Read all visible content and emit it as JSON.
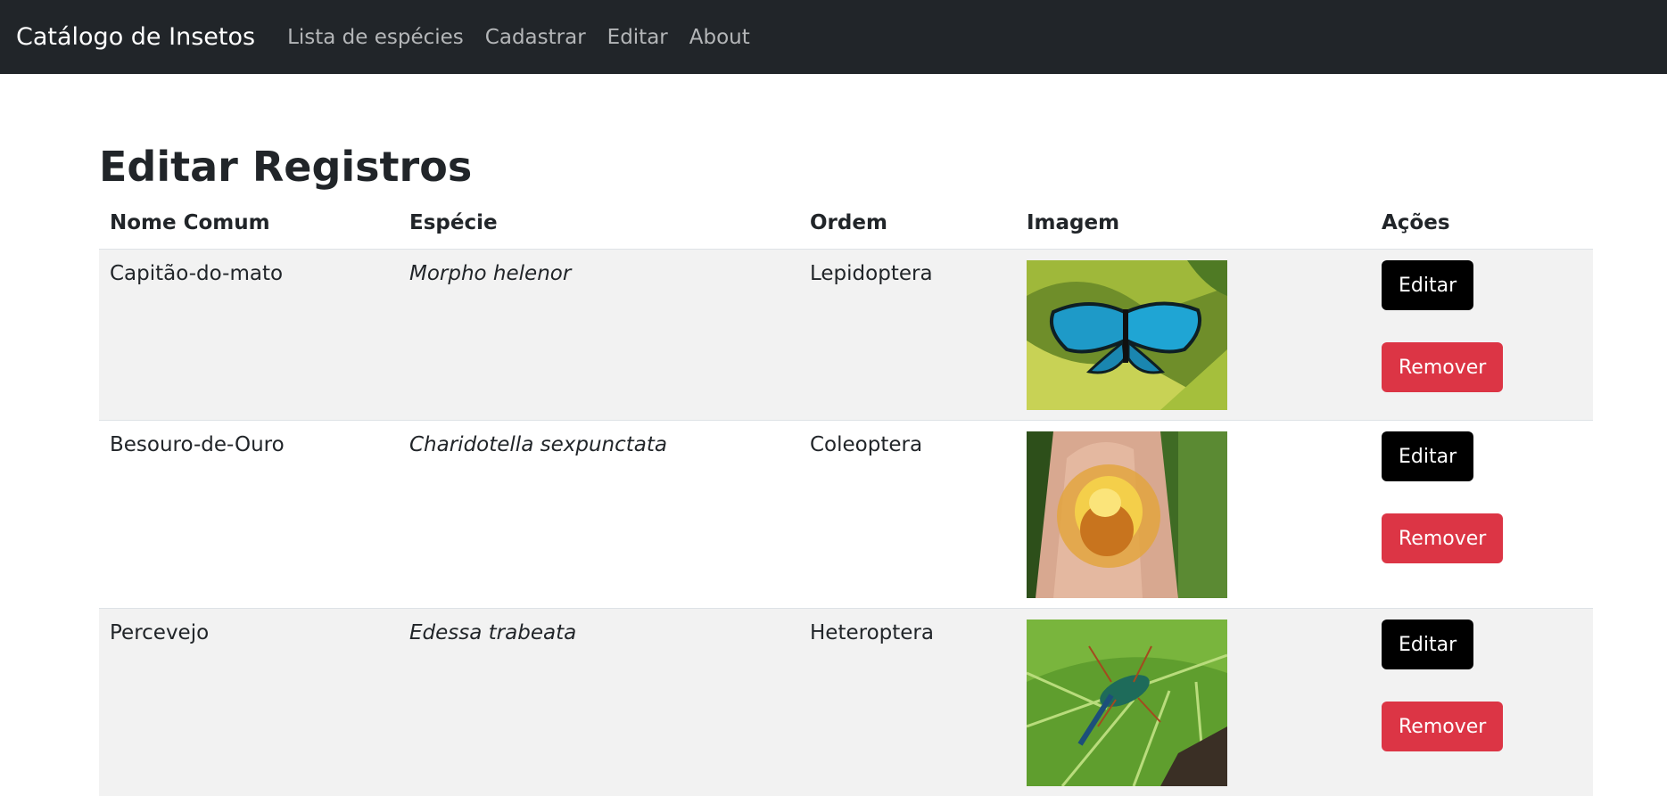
{
  "nav": {
    "brand": "Catálogo de Insetos",
    "links": [
      "Lista de espécies",
      "Cadastrar",
      "Editar",
      "About"
    ]
  },
  "page_title": "Editar Registros",
  "table": {
    "headers": [
      "Nome Comum",
      "Espécie",
      "Ordem",
      "Imagem",
      "Ações"
    ],
    "rows": [
      {
        "common": "Capitão-do-mato",
        "species": "Morpho helenor",
        "order": "Lepidoptera",
        "image": "blue-butterfly-photo"
      },
      {
        "common": "Besouro-de-Ouro",
        "species": "Charidotella sexpunctata",
        "order": "Coleoptera",
        "image": "golden-beetle-photo"
      },
      {
        "common": "Percevejo",
        "species": "Edessa trabeata",
        "order": "Heteroptera",
        "image": "stink-bug-photo"
      }
    ]
  },
  "actions": {
    "edit_label": "Editar",
    "remove_label": "Remover"
  },
  "colors": {
    "navbar": "#212529",
    "remove": "#dc3545",
    "edit": "#000000",
    "stripe": "#f2f2f2"
  }
}
